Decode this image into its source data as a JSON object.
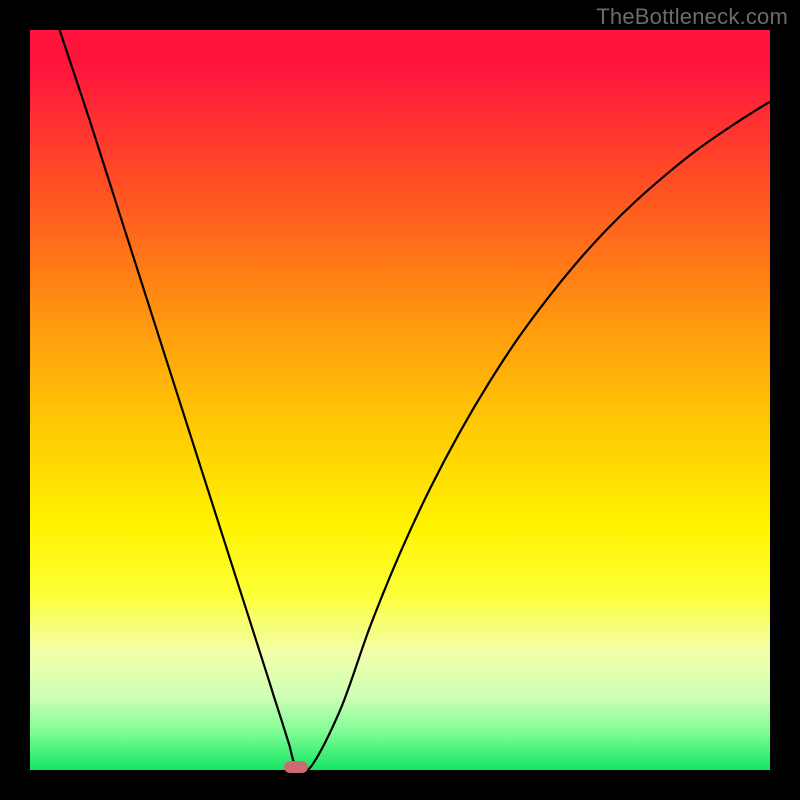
{
  "watermark": "TheBottleneck.com",
  "chart_data": {
    "type": "line",
    "title": "",
    "xlabel": "",
    "ylabel": "",
    "xlim": [
      0,
      100
    ],
    "ylim": [
      0,
      100
    ],
    "grid": false,
    "legend": false,
    "annotations": [],
    "series": [
      {
        "name": "bottleneck-curve",
        "x": [
          4,
          8,
          12,
          16,
          20,
          24,
          28,
          32,
          33,
          34,
          35,
          36,
          38,
          42,
          46,
          50,
          54,
          58,
          62,
          66,
          70,
          74,
          78,
          82,
          86,
          90,
          94,
          98,
          100
        ],
        "values": [
          100,
          88,
          75.5,
          63,
          50.5,
          38,
          25.5,
          13,
          9.8,
          6.7,
          3.5,
          0.4,
          0.5,
          8.3,
          19.5,
          29.3,
          37.9,
          45.5,
          52.3,
          58.4,
          63.8,
          68.7,
          73.1,
          77,
          80.5,
          83.7,
          86.5,
          89.1,
          90.3
        ]
      }
    ],
    "marker": {
      "x": 36,
      "y": 0.4
    },
    "gradient_stops": [
      {
        "pos": 0.0,
        "color": "#ff153c"
      },
      {
        "pos": 0.05,
        "color": "#ff153c"
      },
      {
        "pos": 0.22,
        "color": "#ff5322"
      },
      {
        "pos": 0.4,
        "color": "#ff9a0e"
      },
      {
        "pos": 0.55,
        "color": "#ffce02"
      },
      {
        "pos": 0.67,
        "color": "#fff300"
      },
      {
        "pos": 0.76,
        "color": "#fdff35"
      },
      {
        "pos": 0.84,
        "color": "#f2ffa8"
      },
      {
        "pos": 0.9,
        "color": "#cfffb6"
      },
      {
        "pos": 0.95,
        "color": "#7cfd94"
      },
      {
        "pos": 1.0,
        "color": "#14e562"
      }
    ]
  }
}
